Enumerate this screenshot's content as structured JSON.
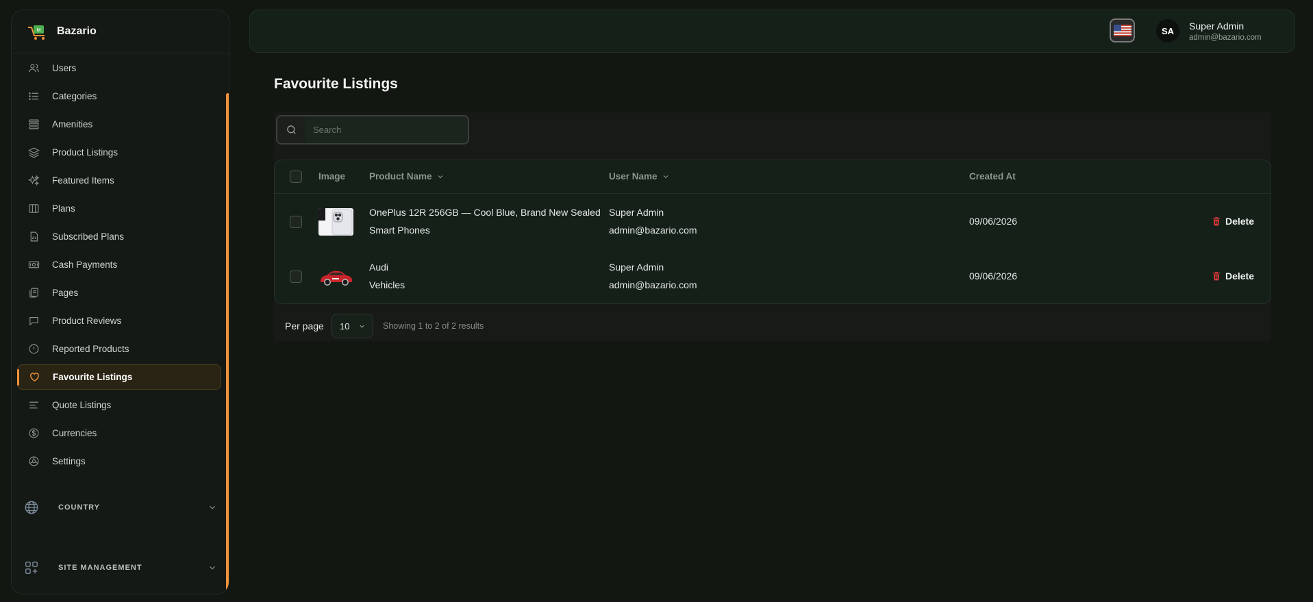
{
  "brand": {
    "name": "Bazario"
  },
  "sidebar": {
    "items": [
      {
        "label": "Users",
        "icon": "users-icon",
        "active": false
      },
      {
        "label": "Categories",
        "icon": "list-icon",
        "active": false
      },
      {
        "label": "Amenities",
        "icon": "layers-stack-icon",
        "active": false
      },
      {
        "label": "Product Listings",
        "icon": "layers-icon",
        "active": false
      },
      {
        "label": "Featured Items",
        "icon": "sparkles-icon",
        "active": false
      },
      {
        "label": "Plans",
        "icon": "columns-icon",
        "active": false
      },
      {
        "label": "Subscribed Plans",
        "icon": "document-chart-icon",
        "active": false
      },
      {
        "label": "Cash Payments",
        "icon": "cash-icon",
        "active": false
      },
      {
        "label": "Pages",
        "icon": "pages-icon",
        "active": false
      },
      {
        "label": "Product Reviews",
        "icon": "chat-bubble-icon",
        "active": false
      },
      {
        "label": "Reported Products",
        "icon": "alert-circle-icon",
        "active": false
      },
      {
        "label": "Favourite Listings",
        "icon": "heart-icon",
        "active": true
      },
      {
        "label": "Quote Listings",
        "icon": "align-left-icon",
        "active": false
      },
      {
        "label": "Currencies",
        "icon": "dollar-circle-icon",
        "active": false
      },
      {
        "label": "Settings",
        "icon": "settings-icon",
        "active": false
      }
    ],
    "sections": [
      {
        "label": "COUNTRY",
        "icon": "globe-icon"
      },
      {
        "label": "SITE MANAGEMENT",
        "icon": "grid-plus-icon"
      }
    ]
  },
  "header": {
    "language_icon": "us-flag-icon",
    "user": {
      "initials": "SA",
      "name": "Super Admin",
      "email": "admin@bazario.com"
    }
  },
  "page": {
    "title": "Favourite Listings"
  },
  "search": {
    "placeholder": "Search",
    "value": ""
  },
  "table": {
    "columns": [
      "Image",
      "Product Name",
      "User Name",
      "Created At"
    ],
    "rows": [
      {
        "image": "phone-image",
        "product_name": "OnePlus 12R 256GB — Cool Blue, Brand New Sealed",
        "category": "Smart Phones",
        "user_name": "Super Admin",
        "user_email": "admin@bazario.com",
        "created_at": "09/06/2026",
        "action": "Delete"
      },
      {
        "image": "car-image",
        "product_name": "Audi",
        "category": "Vehicles",
        "user_name": "Super Admin",
        "user_email": "admin@bazario.com",
        "created_at": "09/06/2026",
        "action": "Delete"
      }
    ]
  },
  "pagination": {
    "per_page_label": "Per page",
    "per_page_value": "10",
    "summary": "Showing 1 to 2 of 2 results"
  },
  "colors": {
    "accent": "#f0923a",
    "danger": "#e03b3b",
    "background": "#121712"
  }
}
